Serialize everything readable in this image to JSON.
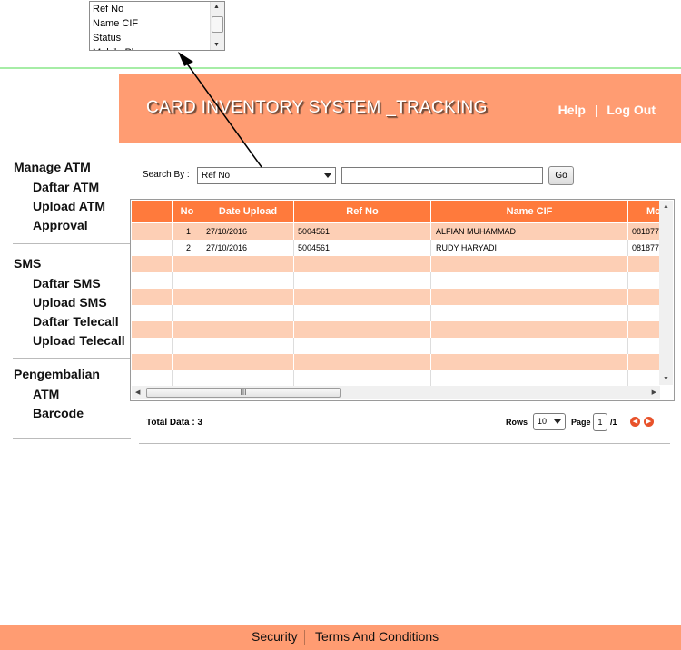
{
  "popup": {
    "options": [
      "Ref No",
      "Name CIF",
      "Status",
      "Mobile Phone"
    ]
  },
  "header": {
    "title": "CARD INVENTORY SYSTEM _TRACKING",
    "help": "Help",
    "separator": "|",
    "logout": "Log Out"
  },
  "sidebar": {
    "sections": [
      {
        "title": "Manage ATM",
        "items": [
          "Daftar ATM",
          "Upload ATM",
          "Approval"
        ]
      },
      {
        "title": "SMS",
        "items": [
          "Daftar SMS",
          "Upload SMS",
          "Daftar Telecall",
          "Upload Telecall"
        ]
      },
      {
        "title": "Pengembalian",
        "items": [
          "ATM",
          "Barcode"
        ]
      }
    ]
  },
  "search": {
    "label": "Search By :",
    "selected": "Ref No",
    "value": "",
    "go": "Go"
  },
  "grid": {
    "columns": [
      "",
      "No",
      "Date Upload",
      "Ref No",
      "Name CIF",
      "Mo"
    ],
    "rows": [
      [
        "",
        "1",
        "27/10/2016",
        "5004561",
        "ALFIAN MUHAMMAD",
        "081877"
      ],
      [
        "",
        "2",
        "27/10/2016",
        "5004561",
        "RUDY HARYADI",
        "081877"
      ]
    ],
    "scroll_thumb": "III"
  },
  "pager": {
    "total": "Total Data : 3",
    "rows_label": "Rows",
    "rows_value": "10",
    "page_label": "Page",
    "page_value": "1",
    "page_total": "/1"
  },
  "footer": {
    "security": "Security",
    "terms": "Terms And Conditions"
  },
  "colors": {
    "banner": "#ff9c72",
    "grid_header": "#ff7a3c",
    "row_alt": "#fdcfb5"
  }
}
